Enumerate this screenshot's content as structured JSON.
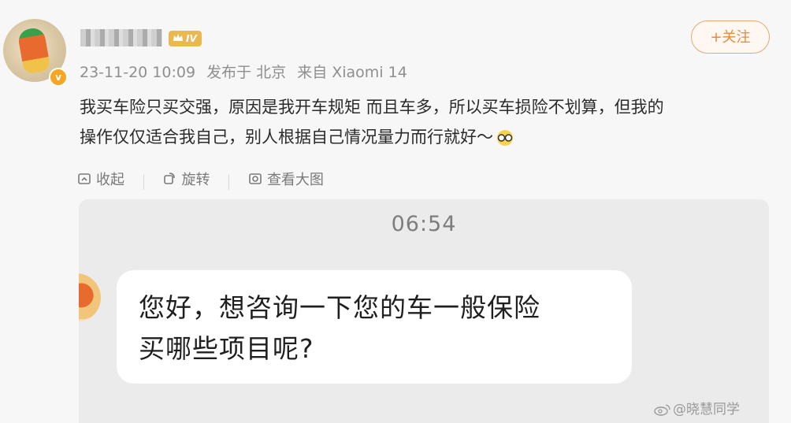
{
  "post": {
    "level_badge": "IV",
    "follow_label": "+关注",
    "meta": {
      "datetime": "23-11-20 10:09",
      "location": "发布于 北京",
      "source": "来自 Xiaomi 14"
    },
    "content": {
      "line1": "我买车险只买交强，原因是我开车规矩 而且车多，所以买车损险不划算，但我的",
      "line2": "操作仅仅适合我自己，别人根据自己情况量力而行就好～"
    },
    "actions": {
      "collapse": "收起",
      "rotate": "旋转",
      "view_large": "查看大图"
    }
  },
  "image": {
    "time": "06:54",
    "message_line1": "您好，想咨询一下您的车一般保险",
    "message_line2": "买哪些项目呢?"
  },
  "watermark": "@晓慧同学",
  "colors": {
    "follow": "#e58b3a",
    "level": "#e9b84f",
    "verified": "#f5a623"
  }
}
